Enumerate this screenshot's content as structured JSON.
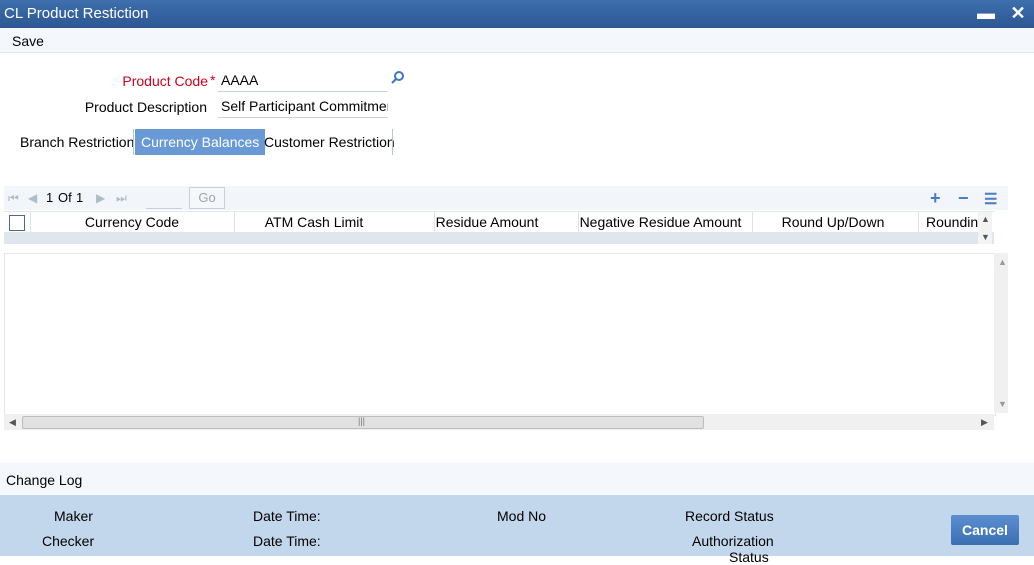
{
  "window": {
    "title": "CL Product Restiction",
    "minimize": "▬",
    "close": "✕"
  },
  "toolbar": {
    "save_label": "Save"
  },
  "form": {
    "product_code_label": "Product Code",
    "required_mark": "*",
    "product_code_value": "AAAA",
    "product_description_label": "Product Description",
    "product_description_value": "Self Participant Commitmen"
  },
  "tabs": [
    {
      "label": "Branch Restriction",
      "active": false
    },
    {
      "label": "Currency Balances",
      "active": true
    },
    {
      "label": "Customer Restriction",
      "active": false
    }
  ],
  "grid": {
    "pager": {
      "current": "1",
      "of_label": "Of",
      "total": "1",
      "go_label": "Go"
    },
    "add_icon": "+",
    "remove_icon": "−",
    "list_icon": "☰",
    "columns": [
      "Currency Code",
      "ATM Cash Limit",
      "Residue Amount",
      "Negative Residue Amount",
      "Round Up/Down",
      "Roundin"
    ],
    "rows": []
  },
  "change_log": {
    "label": "Change Log"
  },
  "footer": {
    "maker_label": "Maker",
    "checker_label": "Checker",
    "date_time_label": "Date Time:",
    "mod_no_label": "Mod No",
    "record_status_label": "Record Status",
    "authorization_status_label": "Authorization",
    "authorization_status_label_2": "Status",
    "cancel_label": "Cancel"
  },
  "colors": {
    "title_bar": "#2c5793",
    "active_tab": "#6a9ad6",
    "footer": "#c3d7ec",
    "required": "#d0001f"
  }
}
